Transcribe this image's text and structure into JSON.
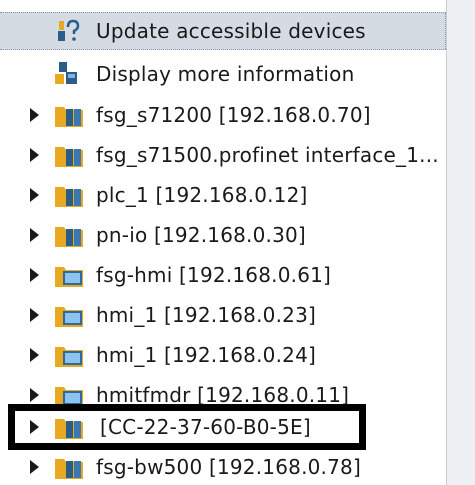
{
  "actions": [
    {
      "label": "Update accessible devices",
      "icon": "update-devices-icon"
    },
    {
      "label": "Display more information",
      "icon": "display-info-icon"
    }
  ],
  "devices": [
    {
      "label": "fsg_s71200 [192.168.0.70]",
      "icon": "plc-device-icon"
    },
    {
      "label": "fsg_s71500.profinet interface_1...",
      "icon": "plc-device-icon"
    },
    {
      "label": "plc_1 [192.168.0.12]",
      "icon": "plc-device-icon"
    },
    {
      "label": "pn-io [192.168.0.30]",
      "icon": "plc-device-icon"
    },
    {
      "label": "fsg-hmi [192.168.0.61]",
      "icon": "hmi-device-icon"
    },
    {
      "label": "hmi_1 [192.168.0.23]",
      "icon": "hmi-device-icon"
    },
    {
      "label": "hmi_1 [192.168.0.24]",
      "icon": "hmi-device-icon"
    },
    {
      "label": "hmitfmdr [192.168.0.11]",
      "icon": "hmi-device-icon"
    },
    {
      "label": "[CC-22-37-60-B0-5E]",
      "icon": "plc-device-icon"
    },
    {
      "label": "fsg-bw500 [192.168.0.78]",
      "icon": "plc-device-icon"
    }
  ],
  "colors": {
    "selection": "#d4dbe3",
    "highlight_border": "#000000",
    "folder": "#e8a820",
    "plc_block": "#2a5d8a",
    "hmi_screen": "#5aa0d8"
  }
}
